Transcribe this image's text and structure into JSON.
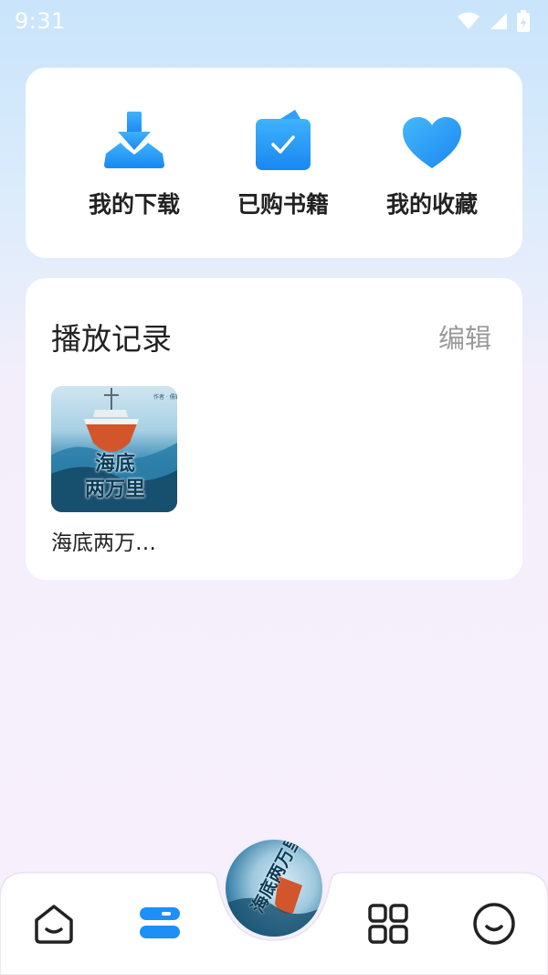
{
  "status_bar": {
    "time": "9:31"
  },
  "quick_actions": [
    {
      "label": "我的下载",
      "icon": "download-icon"
    },
    {
      "label": "已购书籍",
      "icon": "purchased-books-icon"
    },
    {
      "label": "我的收藏",
      "icon": "heart-icon"
    }
  ],
  "history": {
    "title": "播放记录",
    "edit_label": "编辑",
    "items": [
      {
        "name": "海底两万…",
        "cover_title_line1": "海底",
        "cover_title_line2": "两万里"
      }
    ]
  },
  "tab_bar": {
    "tabs": [
      {
        "icon": "home-icon"
      },
      {
        "icon": "bookshelf-icon",
        "active": true
      },
      {
        "icon": "now-playing-disc"
      },
      {
        "icon": "grid-icon"
      },
      {
        "icon": "smile-icon"
      }
    ],
    "disc_title": "海底两万里"
  },
  "colors": {
    "accent": "#1e90f5",
    "accent_light": "#42b4fb",
    "muted": "#9a9a9a"
  }
}
